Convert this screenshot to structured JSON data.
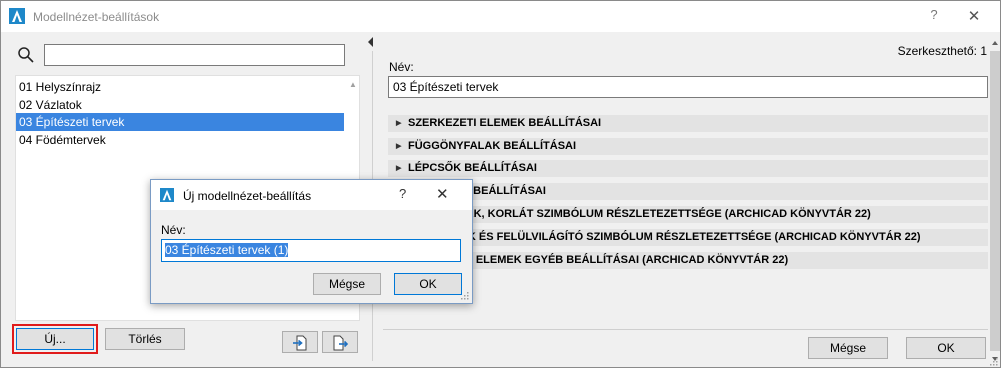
{
  "window": {
    "title": "Modellnézet-beállítások",
    "help_glyph": "?",
    "close_glyph": "✕"
  },
  "search": {
    "value": "",
    "placeholder": "",
    "icon": "search-icon"
  },
  "list": {
    "items": [
      {
        "label": "01 Helyszínrajz",
        "selected": false
      },
      {
        "label": "02 Vázlatok",
        "selected": false
      },
      {
        "label": "03 Építészeti tervek",
        "selected": true
      },
      {
        "label": "04 Födémtervek",
        "selected": false
      }
    ]
  },
  "left_buttons": {
    "new_label": "Új...",
    "delete_label": "Törlés",
    "import_icon": "import-icon",
    "export_icon": "export-icon"
  },
  "right": {
    "editable_label": "Szerkeszthető: 1",
    "name_label": "Név:",
    "name_value": "03 Építészeti tervek",
    "sections": [
      "SZERKEZETI ELEMEK BEÁLLÍTÁSAI",
      "FÜGGÖNYFALAK BEÁLLÍTÁSAI",
      "LÉPCSŐK BEÁLLÍTÁSAI",
      "KORLÁTOK BEÁLLÍTÁSAI",
      "AJTÓ, ABLAK, KORLÁT SZIMBÓLUM RÉSZLETEZETTSÉGE (ARCHICAD KÖNYVTÁR 22)",
      "TETŐABLAK ÉS FELÜLVILÁGÍTÓ SZIMBÓLUM RÉSZLETEZETTSÉGE (ARCHICAD KÖNYVTÁR 22)",
      "KÖNYVTÁRI ELEMEK EGYÉB BEÁLLÍTÁSAI (ARCHICAD KÖNYVTÁR 22)"
    ],
    "cancel_label": "Mégse",
    "ok_label": "OK"
  },
  "dialog": {
    "title": "Új modellnézet-beállítás",
    "help_glyph": "?",
    "close_glyph": "✕",
    "name_label": "Név:",
    "name_value": "03 Építészeti tervek (1)",
    "cancel_label": "Mégse",
    "ok_label": "OK"
  },
  "colors": {
    "selection": "#3a85e0",
    "highlight_outline": "#e01b1b",
    "default_button_border": "#0078d7",
    "section_bg": "#e3e3e3"
  }
}
